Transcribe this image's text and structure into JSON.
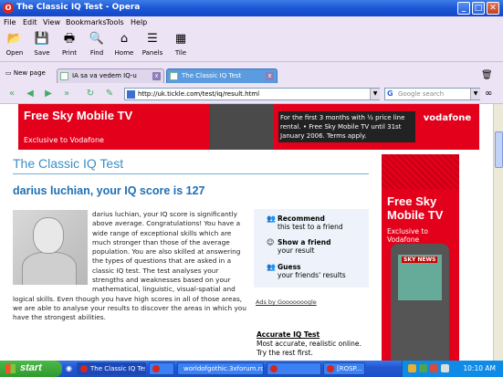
{
  "window": {
    "title": "The Classic IQ Test - Opera",
    "controls": [
      "_",
      "□",
      "✕"
    ]
  },
  "menu": [
    "File",
    "Edit",
    "View",
    "Bookmarks",
    "Tools",
    "Help"
  ],
  "toolbar": [
    {
      "label": "Open",
      "icon": "📂"
    },
    {
      "label": "Save",
      "icon": "💾"
    },
    {
      "label": "Print",
      "icon": "🖶"
    },
    {
      "label": "Find",
      "icon": "🔍"
    },
    {
      "label": "Home",
      "icon": "⌂"
    },
    {
      "label": "Panels",
      "icon": "☰"
    },
    {
      "label": "Tile",
      "icon": "▦"
    }
  ],
  "tabs": {
    "new_page": "New page",
    "items": [
      {
        "label": "IA sa va vedem IQ-u"
      },
      {
        "label": "The Classic IQ Test"
      }
    ]
  },
  "address": {
    "url": "http://uk.tickle.com/test/iq/result.html",
    "search_placeholder": "Google search",
    "search_engine_glyph": "G"
  },
  "banner": {
    "headline": "Free Sky Mobile TV",
    "sub": "Exclusive to Vodafone",
    "promo": "For the first 3 months with ½ price line rental. • Free Sky Mobile TV until 31st January 2006. Terms apply.",
    "brand": "vodafone"
  },
  "page": {
    "title": "The Classic IQ Test",
    "score_line": "darius luchian, your IQ score is 127",
    "result_text": "darius luchian, your IQ score is significantly above average. Congratulations! You have a wide range of exceptional skills which are much stronger than those of the average population. You are also skilled at answering the types of questions that are asked in a classic IQ test. The test analyses your strengths and weaknesses based on your mathematical, linguistic, visual-spatial and logical skills. Even though you have high scores in all of those areas, we are able to analyse your results to discover the areas in which you have the strongest abilities."
  },
  "sidebox": [
    {
      "title": "Recommend",
      "sub": "this test to a friend"
    },
    {
      "title": "Show a friend",
      "sub": "your result"
    },
    {
      "title": "Guess",
      "sub": "your friends' results"
    }
  ],
  "ads_label": "Ads by Gooooooogle",
  "accurate": {
    "title": "Accurate IQ Test",
    "line1": "Most accurate, realistic online.",
    "line2": "Try the rest first."
  },
  "side_ad": {
    "headline": "Free Sky Mobile TV",
    "sub": "Exclusive to Vodafone",
    "news": "SKY NEWS"
  },
  "taskbar": {
    "start": "start",
    "tasks": [
      "The Classic IQ Test -...",
      "",
      "worldofgothic.3xforum.ro",
      "",
      "[ROSP..."
    ],
    "clock": "10:10 AM"
  }
}
